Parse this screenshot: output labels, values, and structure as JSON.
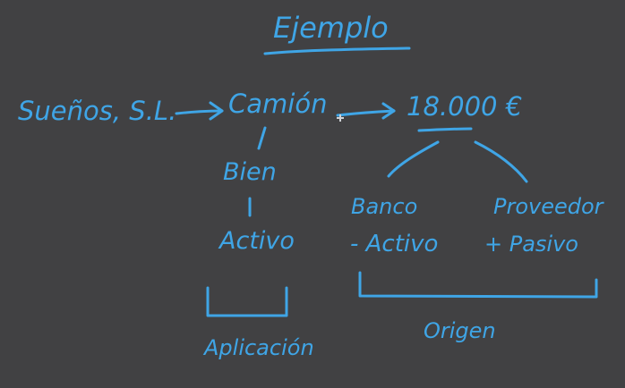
{
  "title": "Ejemplo",
  "company": "Sueños, S.L.",
  "asset": "Camión",
  "amount": "18.000 €",
  "classification": {
    "type": "Bien",
    "category": "Activo",
    "label": "Aplicación"
  },
  "sources": {
    "bank": {
      "name": "Banco",
      "effect": "- Activo"
    },
    "supplier": {
      "name": "Proveedor",
      "effect": "+ Pasivo"
    },
    "label": "Origen"
  },
  "colors": {
    "background": "#414143",
    "ink": "#3fa5e6"
  }
}
